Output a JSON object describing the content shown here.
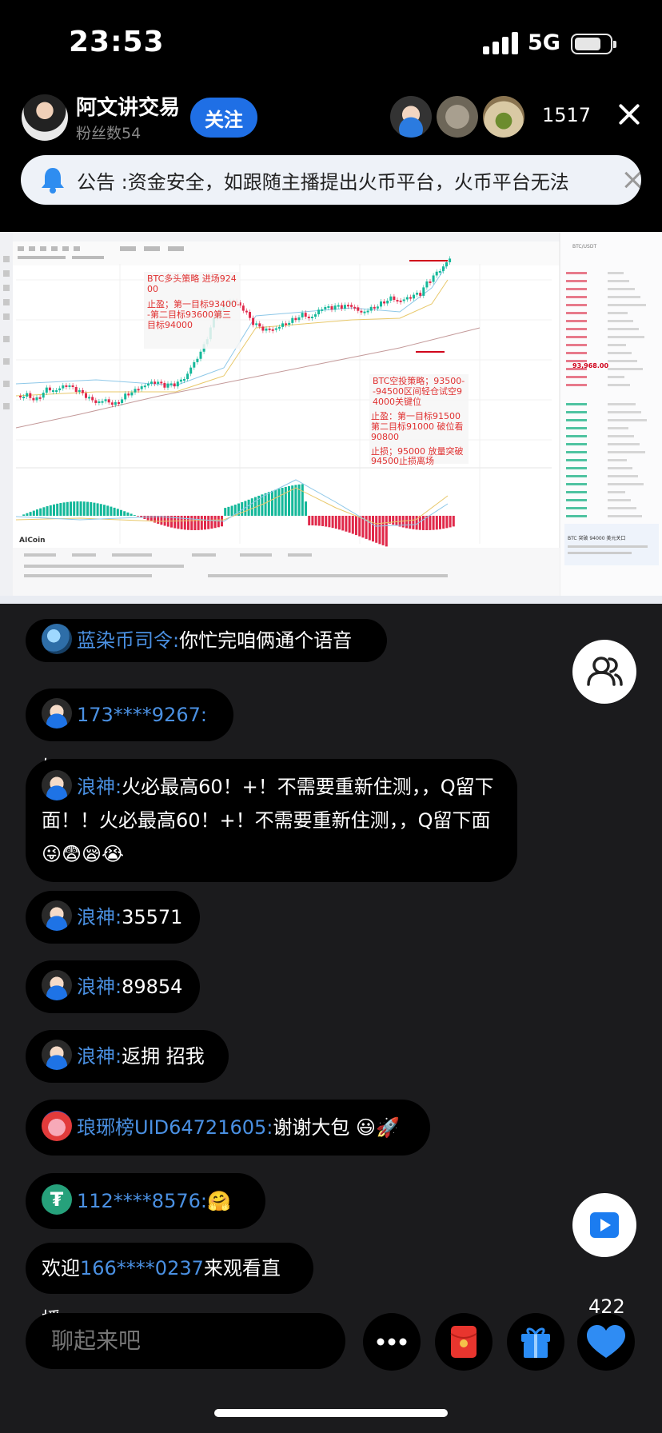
{
  "status_bar": {
    "time": "23:53",
    "network": "5G"
  },
  "host": {
    "name": "阿文讲交易",
    "fans": "粉丝数54",
    "follow_label": "关注"
  },
  "viewer_count": "1517",
  "notice": {
    "text": "公告 :资金安全，如跟随主播提出火币平台，火币平台无法"
  },
  "stream": {
    "annotation_long": [
      "BTC多头策略 进场924",
      "00",
      "止盈；第一目标93400-",
      "-第二目标93600第三",
      "目标94000"
    ],
    "annotation_short": [
      "BTC空投策略；93500-",
      "-94500区间轻仓试空9",
      "4000关键位",
      "止盈：第一目标91500",
      "第二目标91000 破位看",
      "90800",
      "止损；95000 放量突破",
      "94500止损离场"
    ],
    "price_label": "93,968.00",
    "news_title": "BTC 突破 94000 美元关口",
    "watermark": "AICoin"
  },
  "chat_messages": [
    {
      "nick": "蓝染币司令:",
      "text": "你忙完咱俩通个语音"
    },
    {
      "nick": "173****9267:",
      "text": "好"
    },
    {
      "nick": "浪神:",
      "text": "火必最高60！+！不需要重新住测，，Q留下面！！火必最高60！+！不需要重新住测，，Q留下面😜😨😪😭"
    },
    {
      "nick": "浪神:",
      "text": "35571"
    },
    {
      "nick": "浪神:",
      "text": "89854"
    },
    {
      "nick": "浪神:",
      "text": "返拥 招我"
    },
    {
      "nick": "琅琊榜UID64721605:",
      "text": "谢谢大包 😃🚀"
    },
    {
      "nick": "112****8576:",
      "text": "🤗❤️"
    }
  ],
  "welcome": {
    "prefix": "欢迎",
    "user": "166****0237",
    "suffix": "来观看直播"
  },
  "input": {
    "placeholder": "聊起来吧"
  },
  "like_count": "422"
}
